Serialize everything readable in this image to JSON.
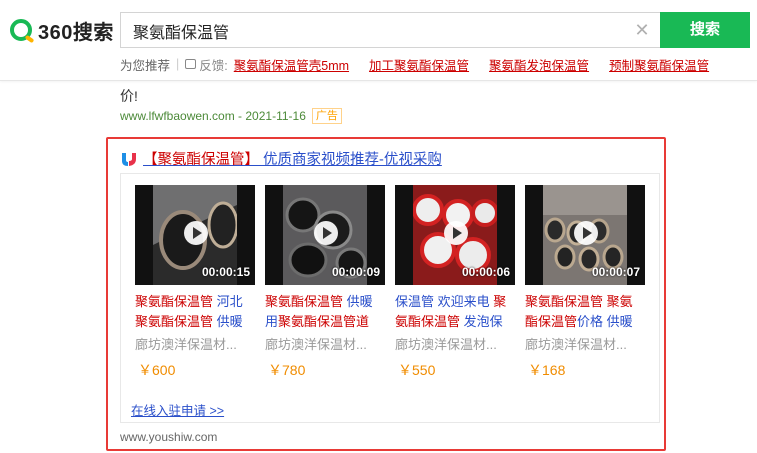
{
  "brand": {
    "logo_text": "360搜索",
    "accent_color": "#19b955",
    "ad_frame_color": "#e83a36",
    "link_color": "#2a4fca",
    "highlight_color": "#cc0000"
  },
  "search": {
    "query": "聚氨酯保温管",
    "button_label": "搜索",
    "clear_icon": "close-icon"
  },
  "recommend": {
    "label": "为您推荐",
    "feedback_label": "反馈:",
    "links": [
      "聚氨酯保温管壳5mm",
      "加工聚氨酯保温管",
      "聚氨酯发泡保温管",
      "预制聚氨酯保温管"
    ]
  },
  "previous_result": {
    "text_tail": "价!",
    "url": "www.lfwfbaowen.com - 2021-11-16",
    "ad_badge": "广告"
  },
  "ad": {
    "title_bracketed": "【聚氨酯保温管】",
    "title_rest": " 优质商家视频推荐-优视采购",
    "videos": [
      {
        "duration": "00:00:15",
        "desc_red": "聚氨酯保温管",
        "desc_blue": " 河北",
        "desc2_red": "聚氨酯保温管",
        "desc2_blue": " 供暖",
        "shop": "廊坊澳洋保温材...",
        "price": "￥600"
      },
      {
        "duration": "00:00:09",
        "desc_red": "聚氨酯保温管",
        "desc_blue": " 供暖",
        "desc2_blue": "用",
        "desc2_red": "聚氨酯保温管道",
        "shop": "廊坊澳洋保温材...",
        "price": "￥780"
      },
      {
        "duration": "00:00:06",
        "desc_blue": "保温管 欢迎来电 ",
        "desc_red": "聚",
        "desc2_red": "氨酯保温管",
        "desc2_blue": " 发泡保",
        "shop": "廊坊澳洋保温材...",
        "price": "￥550"
      },
      {
        "duration": "00:00:07",
        "desc_red": "聚氨酯保温管 聚氨",
        "desc2_red": "酯保温管",
        "desc2_blue": "价格 供暖",
        "shop": "廊坊澳洋保温材...",
        "price": "￥168"
      }
    ],
    "apply_link": "在线入驻申请 >>",
    "url": "www.youshiw.com"
  }
}
